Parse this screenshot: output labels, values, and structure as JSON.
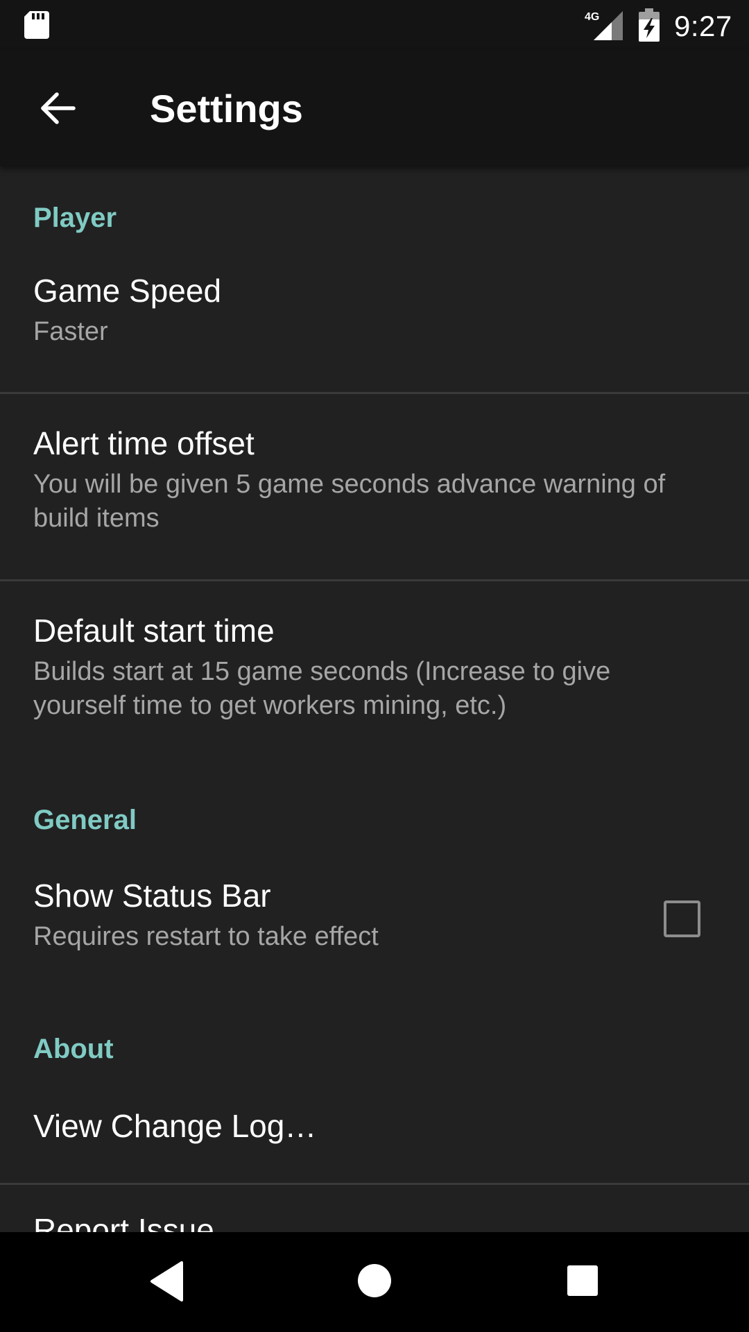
{
  "status_bar": {
    "time": "9:27",
    "network_label": "4G",
    "icons": [
      "sd-card-icon",
      "signal-4g-icon",
      "battery-charging-icon"
    ]
  },
  "toolbar": {
    "title": "Settings",
    "back_icon": "arrow-back-icon"
  },
  "sections": {
    "player": {
      "header": "Player",
      "game_speed": {
        "title": "Game Speed",
        "summary": "Faster"
      },
      "alert_time_offset": {
        "title": "Alert time offset",
        "summary": "You will be given 5 game seconds advance warning of build items"
      },
      "default_start_time": {
        "title": "Default start time",
        "summary": "Builds start at 15 game seconds (Increase to give yourself time to get workers mining, etc.)"
      }
    },
    "general": {
      "header": "General",
      "show_status_bar": {
        "title": "Show Status Bar",
        "summary": "Requires restart to take effect",
        "checked": false
      }
    },
    "about": {
      "header": "About",
      "view_change_log": {
        "title": "View Change Log…"
      },
      "next_item_partial": {
        "title": "Report Issue"
      }
    }
  },
  "nav_bar": {
    "buttons": [
      "nav-back-icon",
      "nav-home-icon",
      "nav-recents-icon"
    ]
  },
  "colors": {
    "background": "#212121",
    "toolbar": "#141414",
    "accent": "#80cbc4",
    "summary_text": "#a6a6a6",
    "divider": "#3a3a3a"
  }
}
